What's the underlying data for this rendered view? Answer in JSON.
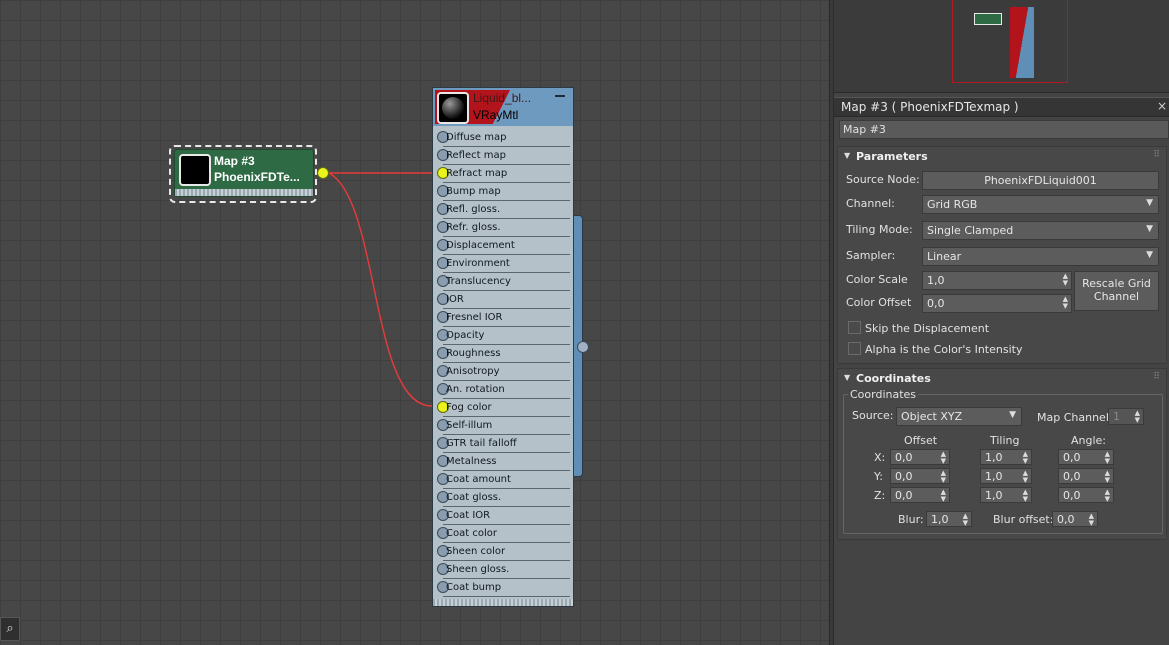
{
  "canvas": {
    "map_node": {
      "title": "Map #3",
      "subtitle": "PhoenixFDTe..."
    },
    "material_node": {
      "name": "Liquid_bl...",
      "type": "VRayMtl",
      "slots": [
        {
          "label": "Diffuse map",
          "connected": false
        },
        {
          "label": "Reflect map",
          "connected": false
        },
        {
          "label": "Refract map",
          "connected": true
        },
        {
          "label": "Bump map",
          "connected": false
        },
        {
          "label": "Refl. gloss.",
          "connected": false
        },
        {
          "label": "Refr. gloss.",
          "connected": false
        },
        {
          "label": "Displacement",
          "connected": false
        },
        {
          "label": "Environment",
          "connected": false
        },
        {
          "label": "Translucency",
          "connected": false
        },
        {
          "label": "IOR",
          "connected": false
        },
        {
          "label": "Fresnel IOR",
          "connected": false
        },
        {
          "label": "Opacity",
          "connected": false
        },
        {
          "label": "Roughness",
          "connected": false
        },
        {
          "label": "Anisotropy",
          "connected": false
        },
        {
          "label": "An. rotation",
          "connected": false
        },
        {
          "label": "Fog color",
          "connected": true
        },
        {
          "label": "Self-illum",
          "connected": false
        },
        {
          "label": "GTR tail falloff",
          "connected": false
        },
        {
          "label": "Metalness",
          "connected": false
        },
        {
          "label": "Coat amount",
          "connected": false
        },
        {
          "label": "Coat gloss.",
          "connected": false
        },
        {
          "label": "Coat IOR",
          "connected": false
        },
        {
          "label": "Coat color",
          "connected": false
        },
        {
          "label": "Sheen color",
          "connected": false
        },
        {
          "label": "Sheen gloss.",
          "connected": false
        },
        {
          "label": "Coat bump",
          "connected": false
        }
      ]
    },
    "colors": {
      "wire": "#e83a3a",
      "socket_on": "#e9f21a",
      "map_node": "#2e6b45",
      "mat_header": "#6e9ac0"
    }
  },
  "panel": {
    "title": "Map #3  ( PhoenixFDTexmap )",
    "close": "×",
    "map_name": "Map #3",
    "parameters": {
      "heading": "Parameters",
      "source_node_label": "Source Node:",
      "source_node_value": "PhoenixFDLiquid001",
      "channel_label": "Channel:",
      "channel_value": "Grid RGB",
      "tiling_label": "Tiling Mode:",
      "tiling_value": "Single Clamped",
      "sampler_label": "Sampler:",
      "sampler_value": "Linear",
      "color_scale_label": "Color Scale",
      "color_scale_value": "1,0",
      "color_offset_label": "Color Offset",
      "color_offset_value": "0,0",
      "rescale_button": "Rescale Grid Channel",
      "skip_displacement": "Skip the Displacement",
      "alpha_intensity": "Alpha is the Color's Intensity"
    },
    "coordinates": {
      "heading": "Coordinates",
      "group_label": "Coordinates",
      "source_label": "Source:",
      "source_value": "Object XYZ",
      "map_channel_label": "Map Channel:",
      "map_channel_value": "1",
      "col_offset": "Offset",
      "col_tiling": "Tiling",
      "col_angle": "Angle:",
      "rows": [
        {
          "axis": "X:",
          "offset": "0,0",
          "tiling": "1,0",
          "angle": "0,0"
        },
        {
          "axis": "Y:",
          "offset": "0,0",
          "tiling": "1,0",
          "angle": "0,0"
        },
        {
          "axis": "Z:",
          "offset": "0,0",
          "tiling": "1,0",
          "angle": "0,0"
        }
      ],
      "blur_label": "Blur:",
      "blur_value": "1,0",
      "blur_offset_label": "Blur offset:",
      "blur_offset_value": "0,0"
    }
  }
}
